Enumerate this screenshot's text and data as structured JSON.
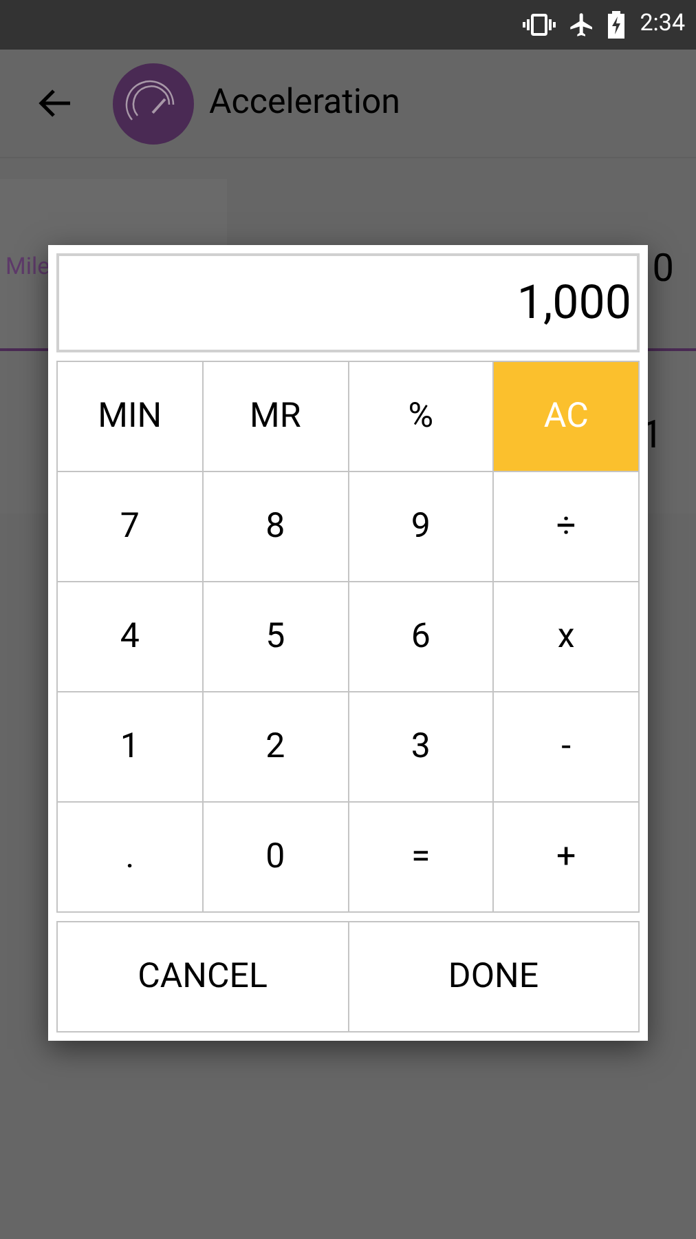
{
  "status_bar": {
    "time": "2:34"
  },
  "app_bar": {
    "title": "Acceleration"
  },
  "background": {
    "unit_label": "Mile",
    "value_1": "0",
    "value_2": "1"
  },
  "calculator": {
    "display": "1,000",
    "keys": [
      {
        "label": "MIN",
        "highlighted": false
      },
      {
        "label": "MR",
        "highlighted": false
      },
      {
        "label": "%",
        "highlighted": false
      },
      {
        "label": "AC",
        "highlighted": true
      },
      {
        "label": "7",
        "highlighted": false
      },
      {
        "label": "8",
        "highlighted": false
      },
      {
        "label": "9",
        "highlighted": false
      },
      {
        "label": "÷",
        "highlighted": false
      },
      {
        "label": "4",
        "highlighted": false
      },
      {
        "label": "5",
        "highlighted": false
      },
      {
        "label": "6",
        "highlighted": false
      },
      {
        "label": "x",
        "highlighted": false
      },
      {
        "label": "1",
        "highlighted": false
      },
      {
        "label": "2",
        "highlighted": false
      },
      {
        "label": "3",
        "highlighted": false
      },
      {
        "label": "-",
        "highlighted": false
      },
      {
        "label": ".",
        "highlighted": false
      },
      {
        "label": "0",
        "highlighted": false
      },
      {
        "label": "=",
        "highlighted": false
      },
      {
        "label": "+",
        "highlighted": false
      }
    ],
    "buttons": [
      "CANCEL",
      "DONE"
    ]
  }
}
